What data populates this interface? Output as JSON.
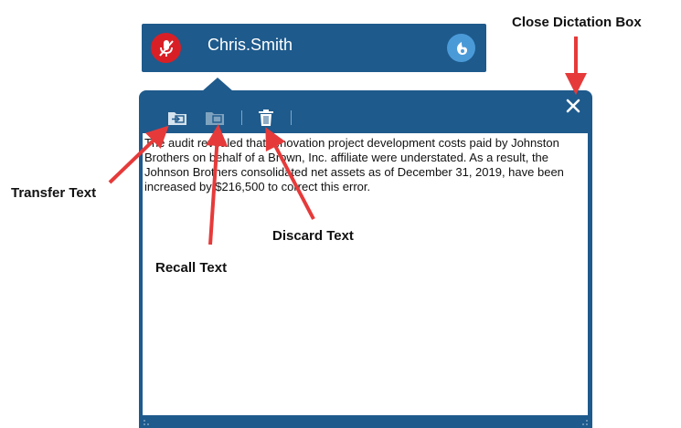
{
  "user_bar": {
    "username": "Chris.Smith",
    "mic_icon": "microphone-muted-icon",
    "dragon_icon": "dragon-logo-icon"
  },
  "dictation_box": {
    "toolbar": {
      "transfer_icon": "transfer-text-icon",
      "recall_icon": "recall-text-icon",
      "discard_icon": "trash-icon",
      "close_icon": "close-icon"
    },
    "text": "The audit revealed that renovation project development costs paid by Johnston Brothers on behalf of a Brown, Inc. affiliate were understated. As a result, the Johnson Brothers consolidated net assets as of December 31, 2019, have been increased by $216,500 to correct this error."
  },
  "annotations": {
    "close": "Close Dictation Box",
    "transfer": "Transfer Text",
    "recall": "Recall Text",
    "discard": "Discard Text"
  },
  "colors": {
    "panel": "#1e5a8c",
    "mic": "#d91f26",
    "dragon": "#4b9ad8",
    "arrow": "#e63a3a"
  }
}
